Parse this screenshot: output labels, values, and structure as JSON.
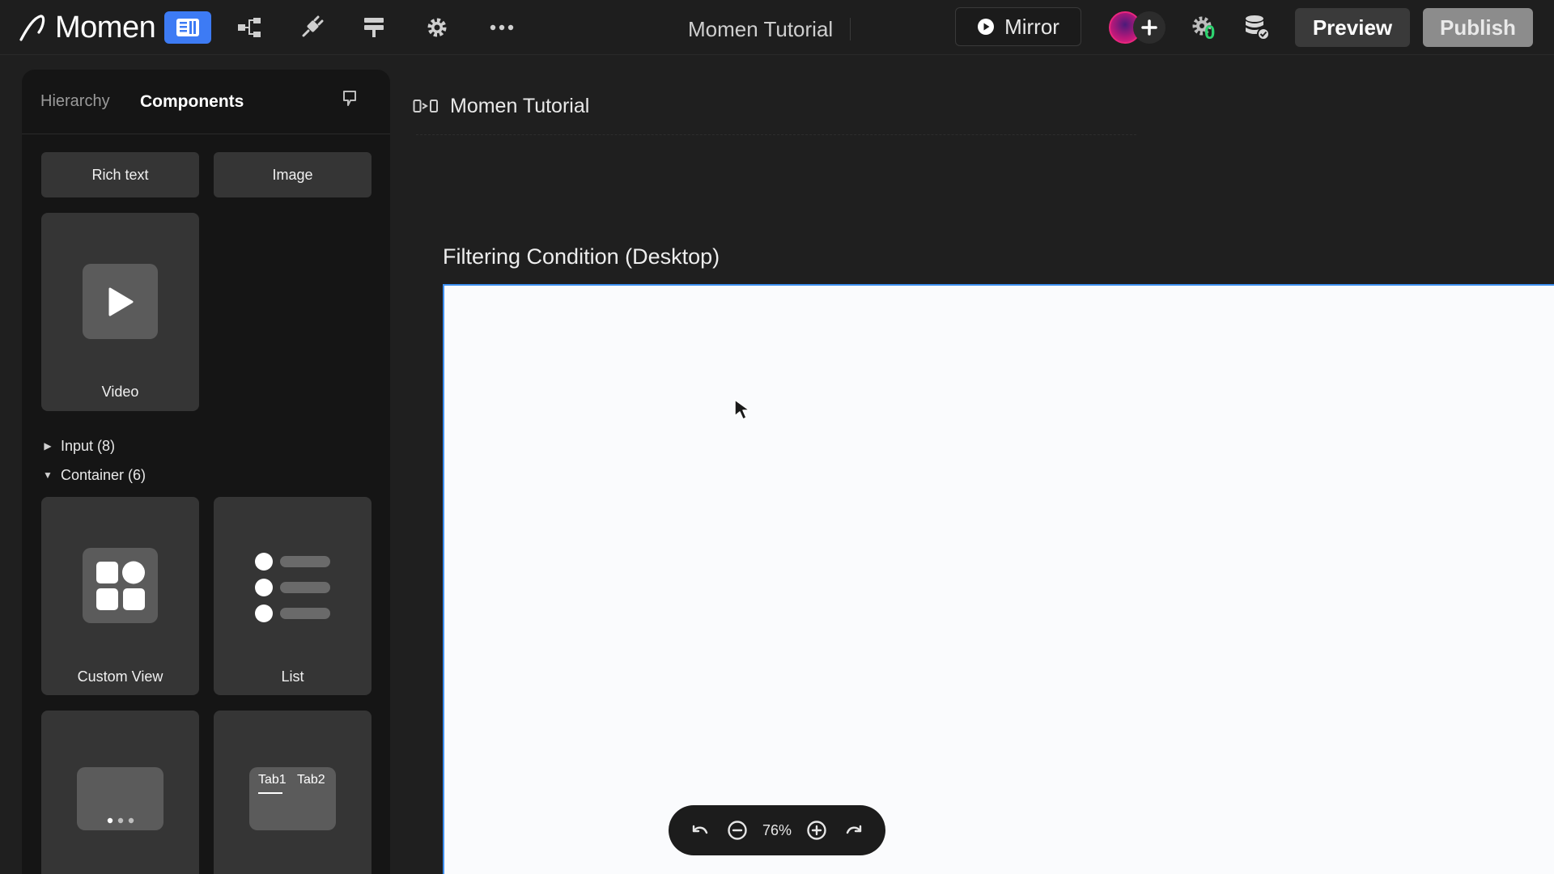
{
  "topbar": {
    "logo_text": "Momen",
    "app_title": "Momen Tutorial",
    "mirror_label": "Mirror",
    "preview_label": "Preview",
    "publish_label": "Publish",
    "debug_badge_count": "0",
    "tools": [
      "pages-icon",
      "logic-flow-icon",
      "plugin-icon",
      "data-model-icon",
      "settings-icon",
      "more-icon"
    ],
    "accent_color": "#3d7bf4"
  },
  "left_panel": {
    "tabs": {
      "hierarchy": "Hierarchy",
      "components": "Components"
    },
    "basic_items": {
      "rich_text": "Rich text",
      "image": "Image",
      "video": "Video"
    },
    "sections": {
      "input": "Input (8)",
      "container": "Container (6)"
    },
    "container_items": {
      "custom_view": "Custom View",
      "list": "List",
      "tab1": "Tab1",
      "tab2": "Tab2"
    }
  },
  "canvas": {
    "breadcrumb": "Momen Tutorial",
    "frame_title": "Filtering Condition (Desktop)",
    "frame_border_color": "#3d8ff0"
  },
  "zoom": {
    "value": "76%"
  }
}
